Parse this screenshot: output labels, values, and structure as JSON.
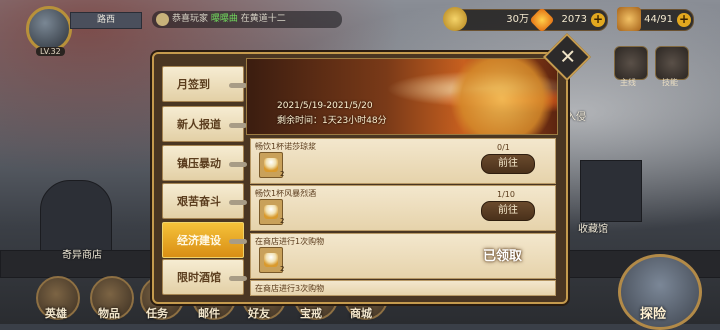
{
  "hud": {
    "player_level": "LV.32",
    "player_name": "路西",
    "ticker_prefix": "恭喜玩家",
    "ticker_highlight": "曝曝曲",
    "ticker_suffix": "在黄道十二",
    "resources": [
      {
        "name": "gold",
        "value": "30万",
        "icon": "gold-coin-icon",
        "color": "#e7b93c"
      },
      {
        "name": "diamond",
        "value": "2073",
        "icon": "diamond-icon",
        "color": "#ff9d1c"
      },
      {
        "name": "stamina",
        "value": "44/91",
        "icon": "stamina-icon",
        "color": "#e8a43a"
      }
    ]
  },
  "side": {
    "right_labels": [
      "主线",
      "技能"
    ],
    "invasion_label": "入侵"
  },
  "scene": {
    "shop_label": "奇异商店",
    "collection_label": "收藏馆"
  },
  "modal": {
    "tabs": [
      {
        "label": "月签到",
        "active": false
      },
      {
        "label": "新人报道",
        "active": false
      },
      {
        "label": "镇压暴动",
        "active": false
      },
      {
        "label": "艰苦奋斗",
        "active": false
      },
      {
        "label": "经济建设",
        "active": true
      },
      {
        "label": "限时酒馆",
        "active": false
      }
    ],
    "banner": {
      "date_range": "2021/5/19-2021/5/20",
      "remaining": "剩余时间：1天23小时48分"
    },
    "tasks": [
      {
        "title": "畅饮1杯诺莎琼浆",
        "qty": "2",
        "progress": "0/1",
        "action": "前往",
        "claimed": false
      },
      {
        "title": "畅饮1杯风暴烈酒",
        "qty": "2",
        "progress": "1/10",
        "action": "前往",
        "claimed": false
      },
      {
        "title": "在商店进行1次购物",
        "qty": "2",
        "progress": "",
        "action": "已领取",
        "claimed": true
      },
      {
        "title": "在商店进行3次购物",
        "qty": "",
        "progress": "",
        "action": "",
        "claimed": false
      }
    ],
    "close_glyph": "✕"
  },
  "nav": {
    "items": [
      "英雄",
      "物品",
      "任务",
      "邮件",
      "好友",
      "宝戒",
      "商城"
    ],
    "explore_label": "探险"
  }
}
